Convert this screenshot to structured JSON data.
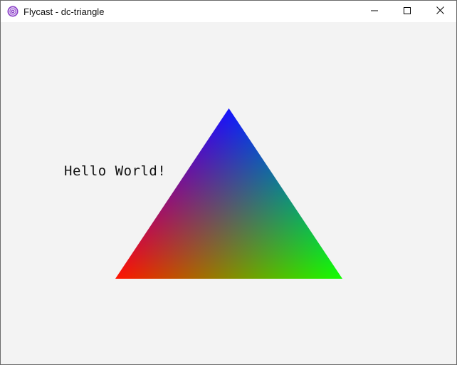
{
  "window": {
    "title": "Flycast - dc-triangle",
    "app_icon": "flycast-swirl-icon",
    "controls": {
      "minimize_icon": "minimize-icon",
      "maximize_icon": "maximize-icon",
      "close_icon": "close-icon"
    }
  },
  "scene": {
    "text": "Hello World!",
    "background_color": "#f3f3f3",
    "triangle": {
      "vertex_colors": {
        "top": "#0000ff",
        "bottom_left": "#ff0000",
        "bottom_right": "#00ff00"
      }
    }
  }
}
